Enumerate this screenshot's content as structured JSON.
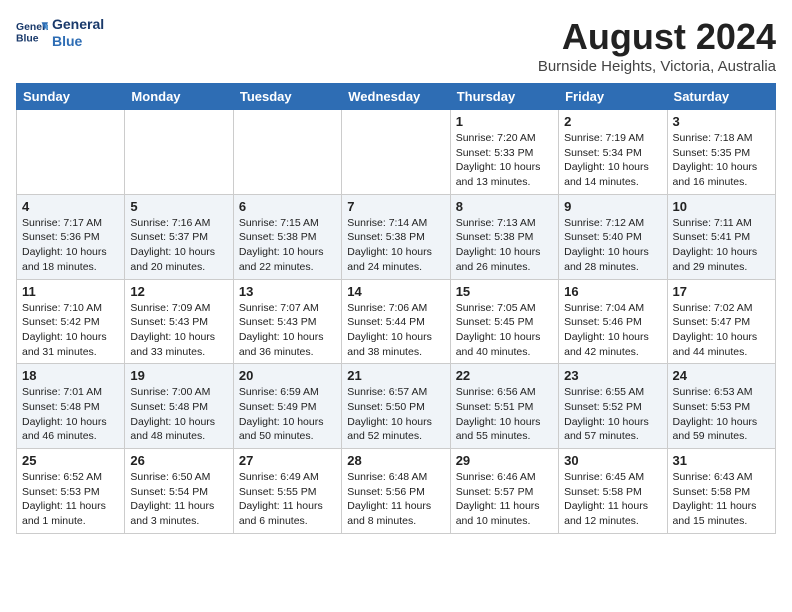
{
  "header": {
    "logo_line1": "General",
    "logo_line2": "Blue",
    "title": "August 2024",
    "location": "Burnside Heights, Victoria, Australia"
  },
  "days_of_week": [
    "Sunday",
    "Monday",
    "Tuesday",
    "Wednesday",
    "Thursday",
    "Friday",
    "Saturday"
  ],
  "weeks": [
    [
      {
        "day": "",
        "info": ""
      },
      {
        "day": "",
        "info": ""
      },
      {
        "day": "",
        "info": ""
      },
      {
        "day": "",
        "info": ""
      },
      {
        "day": "1",
        "info": "Sunrise: 7:20 AM\nSunset: 5:33 PM\nDaylight: 10 hours\nand 13 minutes."
      },
      {
        "day": "2",
        "info": "Sunrise: 7:19 AM\nSunset: 5:34 PM\nDaylight: 10 hours\nand 14 minutes."
      },
      {
        "day": "3",
        "info": "Sunrise: 7:18 AM\nSunset: 5:35 PM\nDaylight: 10 hours\nand 16 minutes."
      }
    ],
    [
      {
        "day": "4",
        "info": "Sunrise: 7:17 AM\nSunset: 5:36 PM\nDaylight: 10 hours\nand 18 minutes."
      },
      {
        "day": "5",
        "info": "Sunrise: 7:16 AM\nSunset: 5:37 PM\nDaylight: 10 hours\nand 20 minutes."
      },
      {
        "day": "6",
        "info": "Sunrise: 7:15 AM\nSunset: 5:38 PM\nDaylight: 10 hours\nand 22 minutes."
      },
      {
        "day": "7",
        "info": "Sunrise: 7:14 AM\nSunset: 5:38 PM\nDaylight: 10 hours\nand 24 minutes."
      },
      {
        "day": "8",
        "info": "Sunrise: 7:13 AM\nSunset: 5:38 PM\nDaylight: 10 hours\nand 26 minutes."
      },
      {
        "day": "9",
        "info": "Sunrise: 7:12 AM\nSunset: 5:40 PM\nDaylight: 10 hours\nand 28 minutes."
      },
      {
        "day": "10",
        "info": "Sunrise: 7:11 AM\nSunset: 5:41 PM\nDaylight: 10 hours\nand 29 minutes."
      }
    ],
    [
      {
        "day": "11",
        "info": "Sunrise: 7:10 AM\nSunset: 5:42 PM\nDaylight: 10 hours\nand 31 minutes."
      },
      {
        "day": "12",
        "info": "Sunrise: 7:09 AM\nSunset: 5:43 PM\nDaylight: 10 hours\nand 33 minutes."
      },
      {
        "day": "13",
        "info": "Sunrise: 7:07 AM\nSunset: 5:43 PM\nDaylight: 10 hours\nand 36 minutes."
      },
      {
        "day": "14",
        "info": "Sunrise: 7:06 AM\nSunset: 5:44 PM\nDaylight: 10 hours\nand 38 minutes."
      },
      {
        "day": "15",
        "info": "Sunrise: 7:05 AM\nSunset: 5:45 PM\nDaylight: 10 hours\nand 40 minutes."
      },
      {
        "day": "16",
        "info": "Sunrise: 7:04 AM\nSunset: 5:46 PM\nDaylight: 10 hours\nand 42 minutes."
      },
      {
        "day": "17",
        "info": "Sunrise: 7:02 AM\nSunset: 5:47 PM\nDaylight: 10 hours\nand 44 minutes."
      }
    ],
    [
      {
        "day": "18",
        "info": "Sunrise: 7:01 AM\nSunset: 5:48 PM\nDaylight: 10 hours\nand 46 minutes."
      },
      {
        "day": "19",
        "info": "Sunrise: 7:00 AM\nSunset: 5:48 PM\nDaylight: 10 hours\nand 48 minutes."
      },
      {
        "day": "20",
        "info": "Sunrise: 6:59 AM\nSunset: 5:49 PM\nDaylight: 10 hours\nand 50 minutes."
      },
      {
        "day": "21",
        "info": "Sunrise: 6:57 AM\nSunset: 5:50 PM\nDaylight: 10 hours\nand 52 minutes."
      },
      {
        "day": "22",
        "info": "Sunrise: 6:56 AM\nSunset: 5:51 PM\nDaylight: 10 hours\nand 55 minutes."
      },
      {
        "day": "23",
        "info": "Sunrise: 6:55 AM\nSunset: 5:52 PM\nDaylight: 10 hours\nand 57 minutes."
      },
      {
        "day": "24",
        "info": "Sunrise: 6:53 AM\nSunset: 5:53 PM\nDaylight: 10 hours\nand 59 minutes."
      }
    ],
    [
      {
        "day": "25",
        "info": "Sunrise: 6:52 AM\nSunset: 5:53 PM\nDaylight: 11 hours\nand 1 minute."
      },
      {
        "day": "26",
        "info": "Sunrise: 6:50 AM\nSunset: 5:54 PM\nDaylight: 11 hours\nand 3 minutes."
      },
      {
        "day": "27",
        "info": "Sunrise: 6:49 AM\nSunset: 5:55 PM\nDaylight: 11 hours\nand 6 minutes."
      },
      {
        "day": "28",
        "info": "Sunrise: 6:48 AM\nSunset: 5:56 PM\nDaylight: 11 hours\nand 8 minutes."
      },
      {
        "day": "29",
        "info": "Sunrise: 6:46 AM\nSunset: 5:57 PM\nDaylight: 11 hours\nand 10 minutes."
      },
      {
        "day": "30",
        "info": "Sunrise: 6:45 AM\nSunset: 5:58 PM\nDaylight: 11 hours\nand 12 minutes."
      },
      {
        "day": "31",
        "info": "Sunrise: 6:43 AM\nSunset: 5:58 PM\nDaylight: 11 hours\nand 15 minutes."
      }
    ]
  ]
}
